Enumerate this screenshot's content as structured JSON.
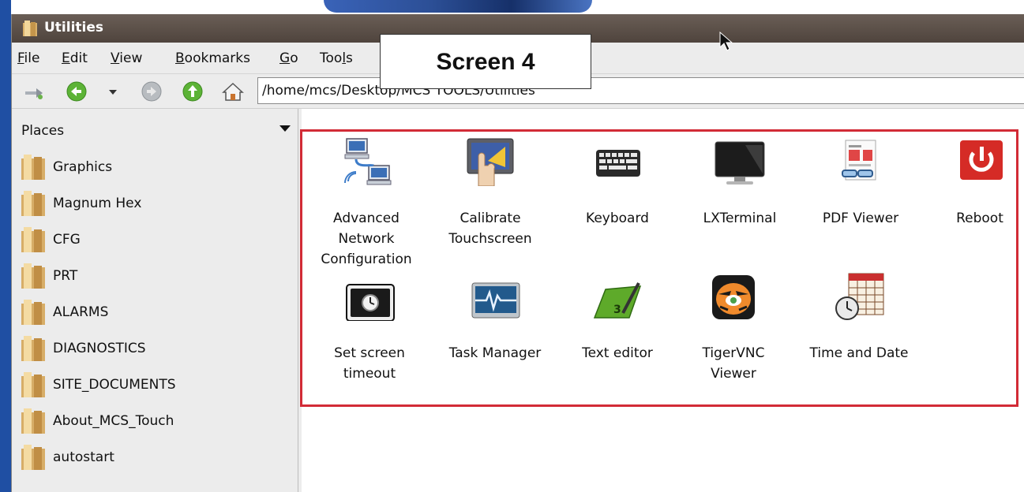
{
  "window": {
    "title": "Utilities"
  },
  "annotation": {
    "text": "Screen 4"
  },
  "menu": [
    {
      "mnemonic": "F",
      "rest": "ile"
    },
    {
      "mnemonic": "E",
      "rest": "dit"
    },
    {
      "mnemonic": "V",
      "rest": "iew"
    },
    {
      "mnemonic": "B",
      "rest": "ookmarks"
    },
    {
      "mnemonic": "G",
      "rest": "o"
    },
    {
      "pre": "Too",
      "mnemonic": "l",
      "rest": "s"
    }
  ],
  "toolbar": {
    "location": "/home/mcs/Desktop/MCS TOOLS/Utilities",
    "icons": [
      "go-to-icon",
      "back-icon",
      "history-dropdown-icon",
      "stop-icon",
      "up-icon",
      "home-icon"
    ]
  },
  "places": {
    "header": "Places",
    "items": [
      {
        "label": "Graphics"
      },
      {
        "label": "Magnum Hex"
      },
      {
        "label": "CFG"
      },
      {
        "label": "PRT"
      },
      {
        "label": "ALARMS"
      },
      {
        "label": "DIAGNOSTICS"
      },
      {
        "label": "SITE_DOCUMENTS"
      },
      {
        "label": "About_MCS_Touch"
      },
      {
        "label": "autostart"
      }
    ]
  },
  "files": [
    {
      "line1": "Advanced",
      "line2": "Network",
      "line3": "Configuration",
      "icon": "network-icon"
    },
    {
      "line1": "Calibrate",
      "line2": "Touchscreen",
      "line3": "",
      "icon": "touchscreen-icon"
    },
    {
      "line1": "Keyboard",
      "line2": "",
      "line3": "",
      "icon": "keyboard-icon"
    },
    {
      "line1": "LXTerminal",
      "line2": "",
      "line3": "",
      "icon": "terminal-icon"
    },
    {
      "line1": "PDF Viewer",
      "line2": "",
      "line3": "",
      "icon": "pdf-icon"
    },
    {
      "line1": "Reboot",
      "line2": "",
      "line3": "",
      "icon": "power-icon"
    },
    {
      "line1": "Set screen",
      "line2": "timeout",
      "line3": "",
      "icon": "screen-timeout-icon"
    },
    {
      "line1": "Task Manager",
      "line2": "",
      "line3": "",
      "icon": "task-manager-icon"
    },
    {
      "line1": "Text editor",
      "line2": "",
      "line3": "",
      "icon": "text-editor-icon"
    },
    {
      "line1": "TigerVNC",
      "line2": "Viewer",
      "line3": "",
      "icon": "tiger-icon"
    },
    {
      "line1": "Time and Date",
      "line2": "",
      "line3": "",
      "icon": "calendar-clock-icon"
    }
  ],
  "colors": {
    "highlight": "#d22b36",
    "titlebar": "#5a4f48"
  }
}
